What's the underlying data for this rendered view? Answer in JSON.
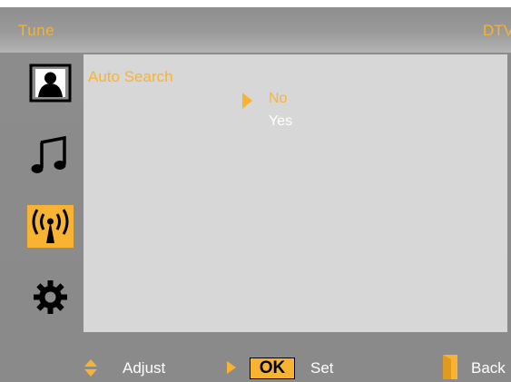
{
  "header": {
    "title": "Tune",
    "source": "DTV"
  },
  "sidebar": {
    "items": [
      {
        "name": "picture",
        "icon": "person-icon"
      },
      {
        "name": "sound",
        "icon": "music-note-icon"
      },
      {
        "name": "tune",
        "icon": "antenna-broadcast-icon",
        "active": true
      },
      {
        "name": "setup",
        "icon": "gear-icon"
      }
    ]
  },
  "panel": {
    "title": "Auto Search",
    "options": [
      {
        "label": "No",
        "selected": true
      },
      {
        "label": "Yes",
        "selected": false
      }
    ]
  },
  "footer": {
    "adjust_label": "Adjust",
    "ok_badge": "OK",
    "set_label": "Set",
    "back_label": "Back"
  },
  "colors": {
    "accent": "#f7b331",
    "panel": "#d7d7d7",
    "background": "#8c8c8c",
    "text": "#ffffff"
  }
}
